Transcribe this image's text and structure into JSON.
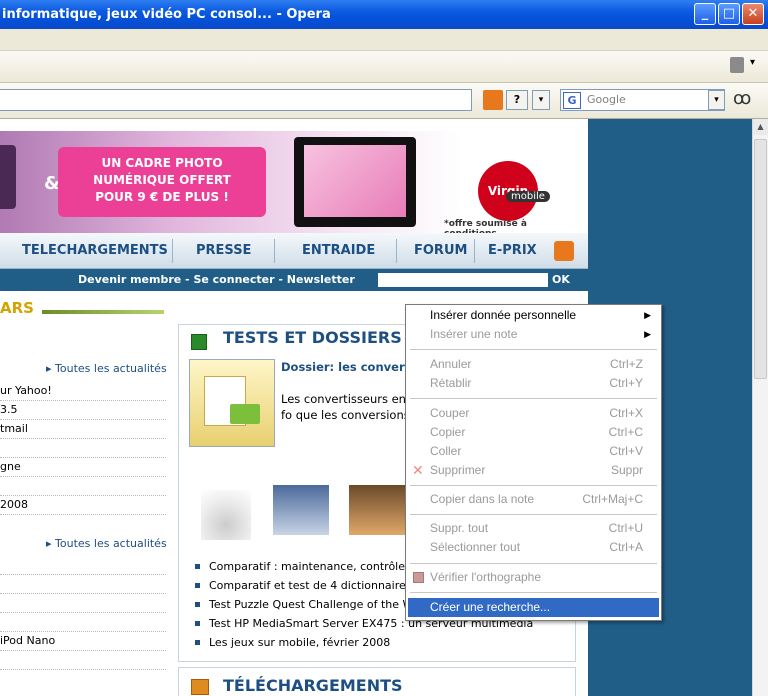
{
  "window": {
    "title": "informatique, jeux vidéo PC consol... - Opera",
    "minimize": "_",
    "maximize": "□",
    "close": "✕"
  },
  "toolbar": {
    "trash_icon": "trash-icon",
    "dropdown": "▾"
  },
  "addressbar": {
    "help": "?",
    "dropdown": "▾",
    "search_placeholder": "Google",
    "search_dropdown": "▾",
    "binoculars": "ꝏ"
  },
  "banner": {
    "promo_line1": "UN CADRE PHOTO",
    "promo_line2": "NUMÉRIQUE OFFERT",
    "promo_line3": "POUR 9 € DE PLUS !",
    "amp": "&",
    "brand": "Virgin",
    "brand_sub": "mobile",
    "offre": "*offre soumise à conditions"
  },
  "nav": {
    "items": [
      "TELECHARGEMENTS",
      "PRESSE",
      "ENTRAIDE",
      "FORUM",
      "E-PRIX"
    ]
  },
  "member": {
    "links": "Devenir membre - Se connecter - Newsletter",
    "ok": "OK"
  },
  "left": {
    "title": "ARS",
    "all_news_1": "Toutes les actualités",
    "all_news_2": "Toutes les actualités",
    "items": [
      "ur Yahoo!",
      "3.5",
      "tmail",
      "",
      "gne",
      "",
      "2008"
    ],
    "items2": [
      "",
      "",
      "",
      "",
      "iPod Nano",
      ""
    ]
  },
  "tests": {
    "title": "TESTS ET DOSSIERS",
    "dossier_title": "Dossier: les convert d'unités en ligne",
    "dossier_text": "Les convertisseurs en bien le passage d'un fo que les conversions d'u",
    "list": [
      "Comparatif : maintenance, contrôle e",
      "Comparatif et test de 4 dictionnaires",
      "Test Puzzle Quest Challenge of the W",
      "Test HP MediaSmart Server EX475 : un serveur multimédia",
      "Les jeux sur mobile, février 2008"
    ]
  },
  "telech": {
    "title": "TÉLÉCHARGEMENTS"
  },
  "context_menu": {
    "items": [
      {
        "label": "Insérer donnée personnelle",
        "shortcut": "",
        "submenu": true,
        "disabled": false
      },
      {
        "label": "Insérer une note",
        "shortcut": "",
        "submenu": true,
        "disabled": true
      },
      {
        "label": "Annuler",
        "shortcut": "Ctrl+Z",
        "disabled": true
      },
      {
        "label": "Rétablir",
        "shortcut": "Ctrl+Y",
        "disabled": true
      },
      {
        "label": "Couper",
        "shortcut": "Ctrl+X",
        "disabled": true
      },
      {
        "label": "Copier",
        "shortcut": "Ctrl+C",
        "disabled": true
      },
      {
        "label": "Coller",
        "shortcut": "Ctrl+V",
        "disabled": true
      },
      {
        "label": "Supprimer",
        "shortcut": "Suppr",
        "disabled": true
      },
      {
        "label": "Copier dans la note",
        "shortcut": "Ctrl+Maj+C",
        "disabled": true
      },
      {
        "label": "Suppr. tout",
        "shortcut": "Ctrl+U",
        "disabled": true
      },
      {
        "label": "Sélectionner tout",
        "shortcut": "Ctrl+A",
        "disabled": true
      },
      {
        "label": "Vérifier l'orthographe",
        "shortcut": "",
        "disabled": true
      },
      {
        "label": "Créer une recherche...",
        "shortcut": "",
        "disabled": false,
        "selected": true
      }
    ]
  }
}
